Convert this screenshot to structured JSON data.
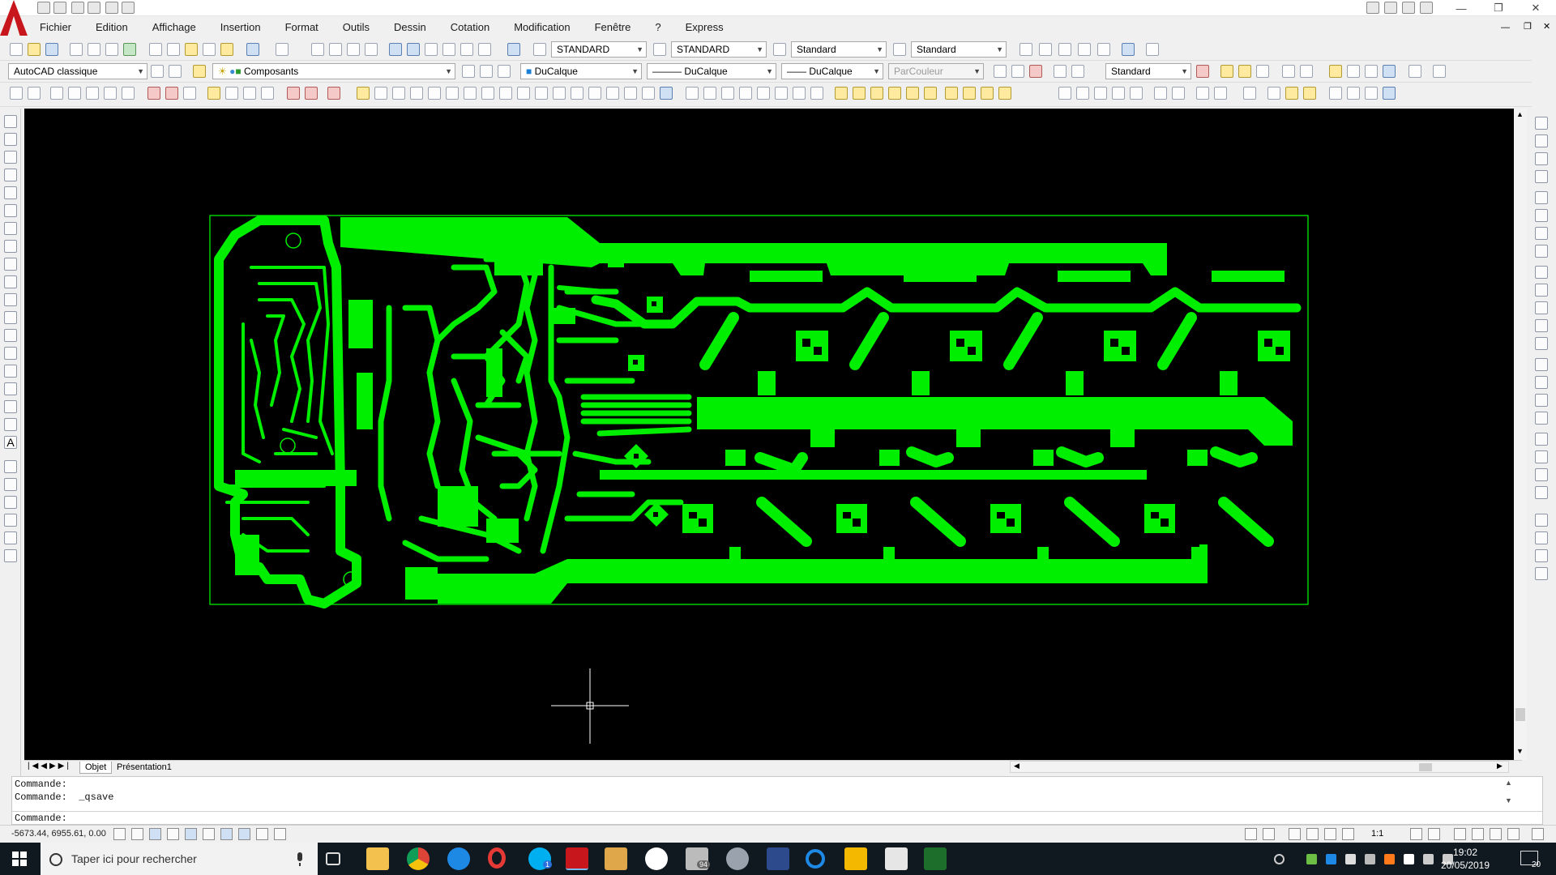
{
  "menus": [
    "Fichier",
    "Edition",
    "Affichage",
    "Insertion",
    "Format",
    "Outils",
    "Dessin",
    "Cotation",
    "Modification",
    "Fenêtre",
    "?",
    "Express"
  ],
  "toolbar1": {
    "text_style": "STANDARD",
    "dim_style": "STANDARD",
    "table_style": "Standard",
    "mleader_style": "Standard"
  },
  "toolbar2": {
    "workspace": "AutoCAD classique",
    "layer": "Composants",
    "color": "DuCalque",
    "linetype": "DuCalque",
    "lineweight": "DuCalque",
    "plotstyle": "ParCouleur",
    "visual_style": "Standard"
  },
  "layout_tabs": [
    "Objet",
    "Présentation1"
  ],
  "command": {
    "history": [
      "Commande:",
      "Commande:  _qsave"
    ],
    "prompt": "Commande:"
  },
  "status": {
    "coordinates": "-5673.44, 6955.61, 0.00",
    "annotation_scale": "1:1"
  },
  "taskbar": {
    "search_placeholder": "Taper ici pour rechercher",
    "time": "19:02",
    "date": "20/05/2019",
    "mail_badge": "94",
    "skype_badge": "1",
    "notif_count": "20"
  },
  "colors": {
    "trace": "#00ee00",
    "board_outline": "#00cc00",
    "viewport_bg": "#000000",
    "taskbar_bg": "#101820"
  }
}
